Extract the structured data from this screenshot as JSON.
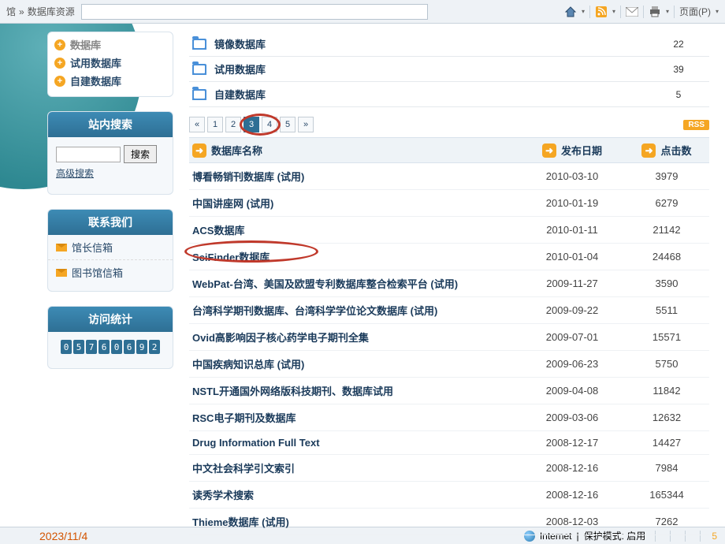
{
  "breadcrumb": {
    "part1": "馆",
    "sep": "»",
    "part2": "数据库资源"
  },
  "toolbar": {
    "page_menu": "页面(P)"
  },
  "sidebar": {
    "nav": [
      {
        "label": "试用数据库"
      },
      {
        "label": "自建数据库"
      }
    ],
    "search_panel_title": "站内搜索",
    "search_btn": "搜索",
    "adv_search": "高级搜索",
    "contact_title": "联系我们",
    "contacts": [
      {
        "label": "馆长信箱"
      },
      {
        "label": "图书馆信箱"
      }
    ],
    "stats_title": "访问统计",
    "counter": [
      "0",
      "5",
      "7",
      "6",
      "0",
      "6",
      "9",
      "2"
    ]
  },
  "categories": [
    {
      "name": "镜像数据库",
      "count": "22"
    },
    {
      "name": "试用数据库",
      "count": "39"
    },
    {
      "name": "自建数据库",
      "count": "5"
    }
  ],
  "pager": {
    "first": "«",
    "pages": [
      "1",
      "2",
      "3",
      "4",
      "5"
    ],
    "active_index": 2,
    "last": "»",
    "rss": "RSS"
  },
  "table": {
    "head_name": "数据库名称",
    "head_date": "发布日期",
    "head_hits": "点击数",
    "rows": [
      {
        "name": "博看畅销刊数据库 (试用)",
        "date": "2010-03-10",
        "hits": "3979"
      },
      {
        "name": "中国讲座网 (试用)",
        "date": "2010-01-19",
        "hits": "6279"
      },
      {
        "name": "ACS数据库",
        "date": "2010-01-11",
        "hits": "21142"
      },
      {
        "name": "SciFinder数据库",
        "date": "2010-01-04",
        "hits": "24468",
        "highlight": true
      },
      {
        "name": "WebPat-台湾、美国及欧盟专利数据库整合检索平台 (试用)",
        "date": "2009-11-27",
        "hits": "3590"
      },
      {
        "name": "台湾科学期刊数据库、台湾科学学位论文数据库 (试用)",
        "date": "2009-09-22",
        "hits": "5511"
      },
      {
        "name": "Ovid高影响因子核心药学电子期刊全集",
        "date": "2009-07-01",
        "hits": "15571"
      },
      {
        "name": "中国疾病知识总库 (试用)",
        "date": "2009-06-23",
        "hits": "5750"
      },
      {
        "name": "NSTL开通国外网络版科技期刊、数据库试用",
        "date": "2009-04-08",
        "hits": "11842"
      },
      {
        "name": "RSC电子期刊及数据库",
        "date": "2009-03-06",
        "hits": "12632"
      },
      {
        "name": "Drug Information Full Text",
        "date": "2008-12-17",
        "hits": "14427"
      },
      {
        "name": "中文社会科学引文索引",
        "date": "2008-12-16",
        "hits": "7984"
      },
      {
        "name": "读秀学术搜索",
        "date": "2008-12-16",
        "hits": "165344"
      },
      {
        "name": "Thieme数据库 (试用)",
        "date": "2008-12-03",
        "hits": "7262"
      }
    ]
  },
  "status": {
    "date": "2023/11/4",
    "zone": "Internet",
    "mode": "保护模式: 启用",
    "page_num": "5"
  }
}
